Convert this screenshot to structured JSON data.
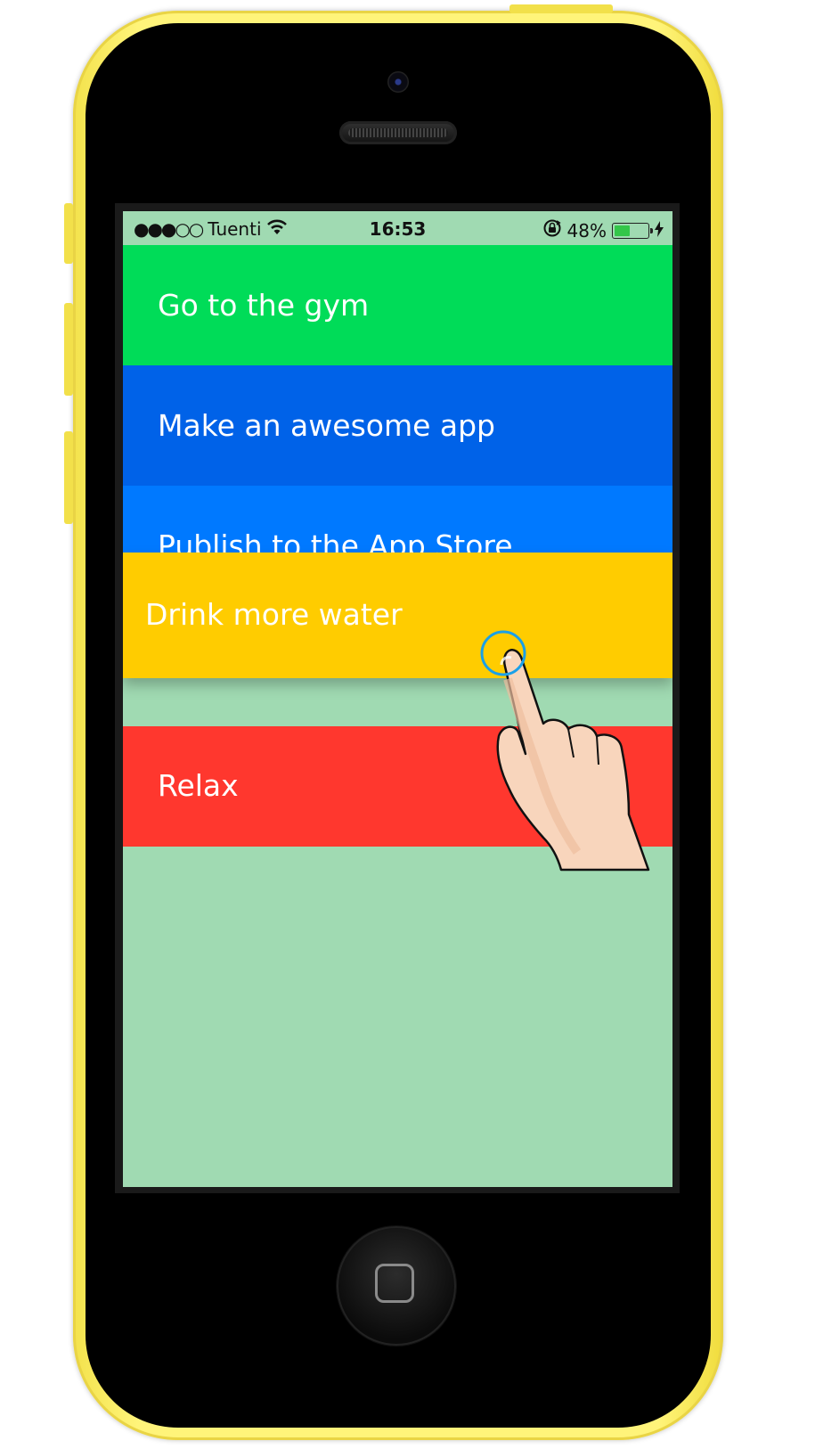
{
  "status_bar": {
    "signal": "●●●○○",
    "carrier": "Tuenti",
    "time": "16:53",
    "battery_percent": "48%",
    "battery_level": 0.48,
    "icons": [
      "wifi-icon",
      "rotation-lock-icon",
      "battery-icon",
      "charging-bolt-icon"
    ]
  },
  "tasks": [
    {
      "label": "Go to the gym",
      "color": "#00dc58"
    },
    {
      "label": "Make an awesome app",
      "color": "#0062e8"
    },
    {
      "label": "Publish to the App Store",
      "color": "#0079ff"
    },
    {
      "label": "Relax",
      "color": "#ff372e"
    }
  ],
  "dragging_task": {
    "label": "Drink more water",
    "color": "#ffcc00"
  },
  "colors": {
    "screen_background": "#a0dab2",
    "phone_shell": "#fff47a"
  },
  "gesture": {
    "icon": "pointing-hand-icon",
    "touch_indicator": "touch-circle-icon"
  }
}
